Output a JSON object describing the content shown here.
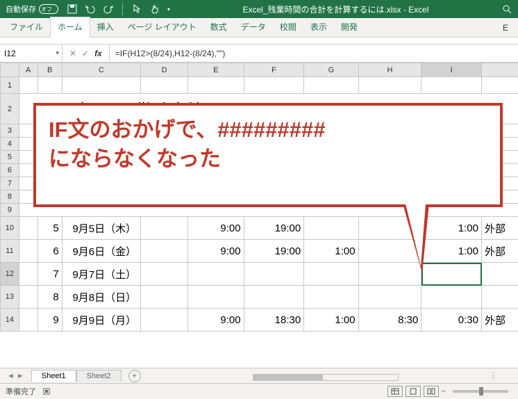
{
  "titlebar": {
    "autosave_label": "自動保存",
    "autosave_state": "オフ",
    "filename": "Excel_残業時間の合計を計算するには.xlsx - Excel"
  },
  "ribbon": {
    "tabs": [
      "ファイル",
      "ホーム",
      "挿入",
      "ページ レイアウト",
      "数式",
      "データ",
      "校閲",
      "表示",
      "開発"
    ],
    "right_letter": "E"
  },
  "formula_bar": {
    "namebox": "I12",
    "formula": "=IF(H12>(8/24),H12-(8/24),\"\")"
  },
  "columns": [
    "",
    "A",
    "B",
    "C",
    "D",
    "E",
    "F",
    "G",
    "H",
    "I",
    ""
  ],
  "rows_visible": [
    "1",
    "2",
    "3",
    "4",
    "5",
    "6",
    "7",
    "8",
    "9",
    "10",
    "11",
    "12",
    "13",
    "14"
  ],
  "title_cell": "2019年9月の勤務実績",
  "data_rows": {
    "r10": {
      "no": "5",
      "date": "9月5日（木）",
      "start": "9:00",
      "end": "19:00",
      "col_g": "",
      "col_h": "",
      "over": "1:00",
      "note": "外部"
    },
    "r11": {
      "no": "6",
      "date": "9月6日（金）",
      "start": "9:00",
      "end": "19:00",
      "col_g": "1:00",
      "col_h": "",
      "over": "1:00",
      "note": "外部"
    },
    "r12": {
      "no": "7",
      "date": "9月7日（土）",
      "start": "",
      "end": "",
      "col_g": "",
      "col_h": "",
      "over": "",
      "note": ""
    },
    "r13": {
      "no": "8",
      "date": "9月8日（日）",
      "start": "",
      "end": "",
      "col_g": "",
      "col_h": "",
      "over": "",
      "note": ""
    },
    "r14": {
      "no": "9",
      "date": "9月9日（月）",
      "start": "9:00",
      "end": "18:30",
      "col_g": "1:00",
      "col_h": "8:30",
      "over": "0:30",
      "note": "外部"
    }
  },
  "callout": {
    "line1": "IF文のおかげで、#########",
    "line2": "にならなくなった"
  },
  "sheets": {
    "active": "Sheet1",
    "other": "Sheet2"
  },
  "status": {
    "ready": "準備完了"
  }
}
